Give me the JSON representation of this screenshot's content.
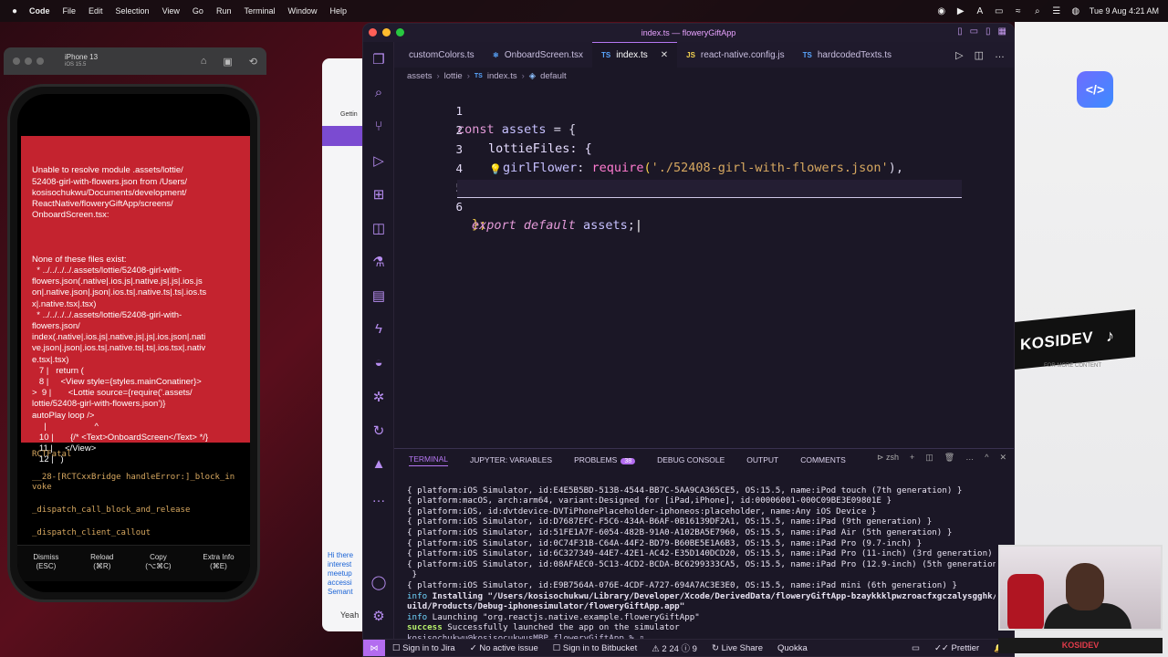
{
  "menubar": {
    "app": "Code",
    "items": [
      "File",
      "Edit",
      "Selection",
      "View",
      "Go",
      "Run",
      "Terminal",
      "Window",
      "Help"
    ],
    "clock": "Tue 9 Aug  4:21 AM"
  },
  "simulator": {
    "device": "iPhone 13",
    "os": "iOS 15.5",
    "error": {
      "header": "Unable to resolve module .assets/lottie/\n52408-girl-with-flowers.json from /Users/\nkosisochukwu/Documents/development/\nReactNative/floweryGiftApp/screens/\nOnboardScreen.tsx:",
      "body": "None of these files exist:\n  * ../../../../.assets/lottie/52408-girl-with-\nflowers.json(.native|.ios.js|.native.js|.js|.ios.js\non|.native.json|.json|.ios.ts|.native.ts|.ts|.ios.ts\nx|.native.tsx|.tsx)\n  * ../../../../.assets/lottie/52408-girl-with-\nflowers.json/\nindex(.native|.ios.js|.native.js|.js|.ios.json|.nati\nve.json|.json|.ios.ts|.native.ts|.ts|.ios.tsx|.nativ\ne.tsx|.tsx)\n   7 |   return (\n   8 |     <View style={styles.mainConatiner}>\n>  9 |       <Lottie source={require('.assets/\nlottie/52408-girl-with-flowers.json')}\nautoPlay loop />\n     |                    ^\n   10 |       {/* <Text>OnboardScreen</Text> */}\n   11 |     </View>\n   12 |   )"
    },
    "stack": [
      "RCTFatal",
      "__28-[RCTCxxBridge handleError:]_block_in\nvoke",
      "_dispatch_call_block_and_release",
      "_dispatch_client_callout"
    ],
    "buttons": [
      {
        "label": "Dismiss",
        "key": "(ESC)"
      },
      {
        "label": "Reload",
        "key": "(⌘R)"
      },
      {
        "label": "Copy",
        "key": "(⌥⌘C)"
      },
      {
        "label": "Extra Info",
        "key": "(⌘E)"
      }
    ]
  },
  "browser": {
    "tab_text": "Gettin",
    "note": "Hi there\ninterest\nmeetup\naccessi\nSemant",
    "yeah": "Yeah"
  },
  "vscode": {
    "window_title": "index.ts — floweryGiftApp",
    "tabs": [
      {
        "label": "customColors.ts",
        "icon": "TS",
        "type": "ts"
      },
      {
        "label": "OnboardScreen.tsx",
        "icon": "⚛",
        "type": "tsx"
      },
      {
        "label": "index.ts",
        "icon": "TS",
        "type": "ts",
        "active": true
      },
      {
        "label": "react-native.config.js",
        "icon": "JS",
        "type": "js"
      },
      {
        "label": "hardcodedTexts.ts",
        "icon": "TS",
        "type": "ts"
      }
    ],
    "breadcrumb": [
      "assets",
      "lottie",
      "index.ts",
      "default"
    ],
    "code": {
      "l1": {
        "n": "1",
        "kw": "const",
        "name": "assets",
        "rest": " = {"
      },
      "l2": {
        "n": "2",
        "text": "lottieFiles: {"
      },
      "l3": {
        "n": "3",
        "key": "girlFlower",
        "fn": "require",
        "str": "'./52408-girl-with-flowers.json'",
        "end": "),"
      },
      "l4": {
        "n": "4",
        "text": "},"
      },
      "l5": {
        "n": "5",
        "text": "};"
      },
      "l6": {
        "n": "6",
        "kw": "export default",
        "name": "assets",
        "end": ";"
      }
    },
    "panel_tabs": [
      "TERMINAL",
      "JUPYTER: VARIABLES",
      "PROBLEMS",
      "DEBUG CONSOLE",
      "OUTPUT",
      "COMMENTS"
    ],
    "problems_count": "38",
    "shell": "zsh",
    "terminal": [
      "{ platform:iOS Simulator, id:E4E5B5BD-513B-4544-BB7C-5AA9CA365CE5, OS:15.5, name:iPod touch (7th generation) }",
      "{ platform:macOS, arch:arm64, variant:Designed for [iPad,iPhone], id:00006001-000C09BE3E09801E }",
      "{ platform:iOS, id:dvtdevice-DVTiPhonePlaceholder-iphoneos:placeholder, name:Any iOS Device }",
      "{ platform:iOS Simulator, id:D7687EFC-F5C6-434A-B6AF-0B16139DF2A1, OS:15.5, name:iPad (9th generation) }",
      "{ platform:iOS Simulator, id:51FE1A7F-6054-482B-91A0-A102BA5E7960, OS:15.5, name:iPad Air (5th generation) }",
      "{ platform:iOS Simulator, id:0C74F31B-C64A-44F2-BD79-B60BE5E1A6B3, OS:15.5, name:iPad Pro (9.7-inch) }",
      "{ platform:iOS Simulator, id:6C327349-44E7-42E1-AC42-E35D140DCD20, OS:15.5, name:iPad Pro (11-inch) (3rd generation) }",
      "{ platform:iOS Simulator, id:08AFAEC0-5C13-4CD2-BCDA-BC6299333CA5, OS:15.5, name:iPad Pro (12.9-inch) (5th generation)",
      " }",
      "{ platform:iOS Simulator, id:E9B7564A-076E-4CDF-A727-694A7AC3E3E0, OS:15.5, name:iPad mini (6th generation) }"
    ],
    "install_prefix": "info",
    "install_text": " Installing \"/Users/kosisochukwu/Library/Developer/Xcode/DerivedData/floweryGiftApp-bzaykkklpwzroacfxgczalysgghk/B",
    "install_text2": "uild/Products/Debug-iphonesimulator/floweryGiftApp.app\"",
    "launch_text": " Launching \"org.reactjs.native.example.floweryGiftApp\"",
    "success_prefix": "success",
    "success_text": " Successfully launched the app on the simulator",
    "prompt": "kosisochukwu@kosisocukwusMBP floweryGiftApp % ▯",
    "status": {
      "jira": "Sign in to Jira",
      "issue": "No active issue",
      "bitbucket": "Sign in to Bitbucket",
      "counts": "⚠ 2  24 ⓘ 9",
      "liveshare": "Live Share",
      "quokka": "Quokka",
      "prettier": "Prettier"
    }
  },
  "overlay": {
    "brand": "KOSIDEV",
    "brand_sub": "FOR MORE CONTENT",
    "cam_label": "KOSIDEV",
    "logo": "</>"
  },
  "colors": {
    "accent": "#b677f3",
    "error_red": "#c4232f"
  }
}
